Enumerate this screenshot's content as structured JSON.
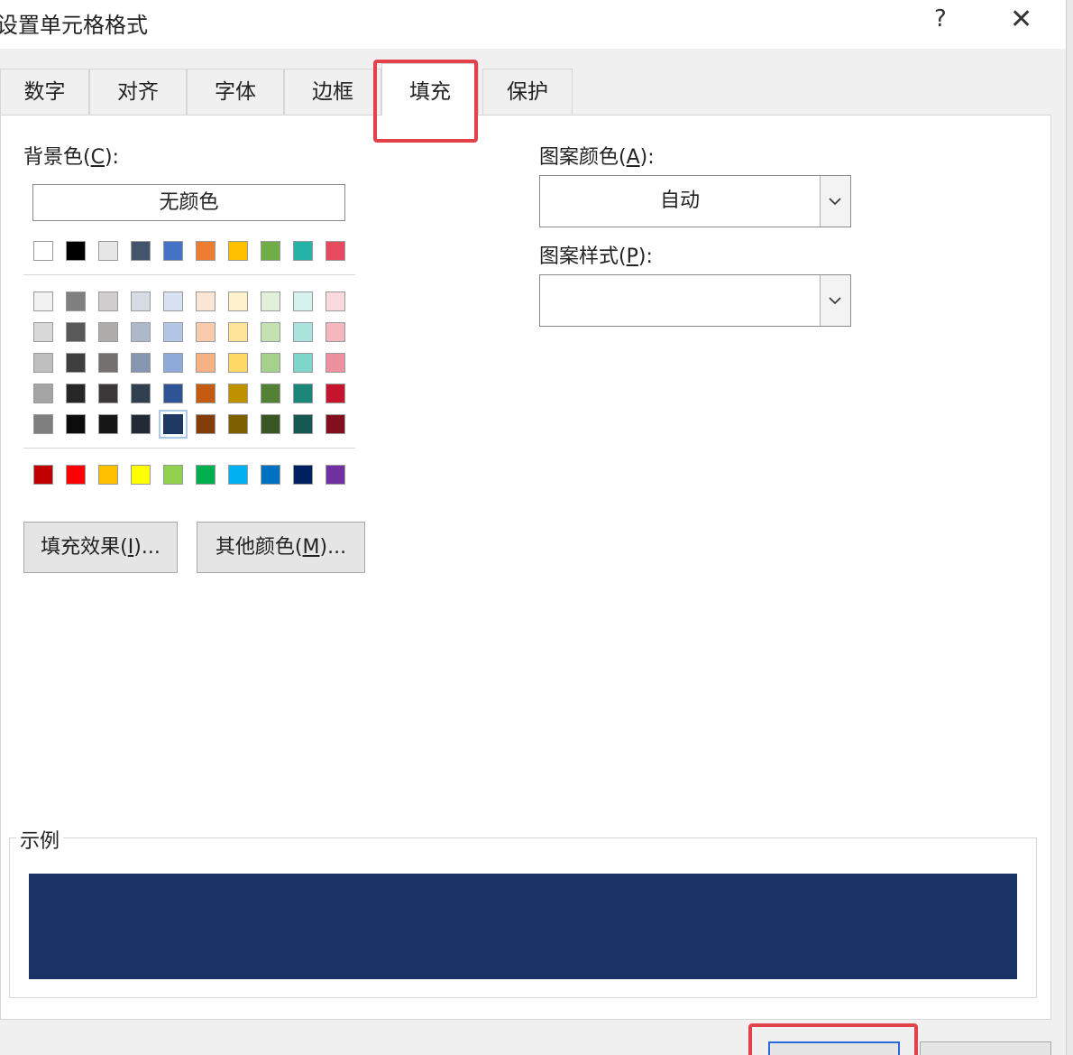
{
  "window": {
    "title": "设置单元格格式",
    "help_label": "?",
    "close_label": "✕"
  },
  "tabs": [
    {
      "label": "数字"
    },
    {
      "label": "对齐"
    },
    {
      "label": "字体"
    },
    {
      "label": "边框"
    },
    {
      "label": "填充",
      "active": true
    },
    {
      "label": "保护"
    }
  ],
  "background": {
    "label_prefix": "背景色(",
    "label_key": "C",
    "label_suffix": "):",
    "no_color_label": "无颜色",
    "selected": "#1f3864",
    "theme_row": [
      "#ffffff",
      "#000000",
      "#e7e6e6",
      "#44546a",
      "#4472c4",
      "#ed7d31",
      "#ffc000",
      "#70ad47",
      "#26b2a6",
      "#e84a5f"
    ],
    "shades": [
      [
        "#f2f2f2",
        "#7f7f7f",
        "#d0cece",
        "#d6dce4",
        "#d9e2f3",
        "#fbe5d5",
        "#fff2cc",
        "#e2efd9",
        "#d4f1ee",
        "#fadadd"
      ],
      [
        "#d8d8d8",
        "#595959",
        "#aeabab",
        "#adb9ca",
        "#b4c6e7",
        "#f7cbac",
        "#fee599",
        "#c5e0b3",
        "#a8e3dc",
        "#f4b6bf"
      ],
      [
        "#bfbfbf",
        "#3f3f3f",
        "#757070",
        "#8496b0",
        "#8eaadb",
        "#f4b183",
        "#ffd966",
        "#a8d08d",
        "#7dd5cb",
        "#ee919e"
      ],
      [
        "#a5a5a5",
        "#262626",
        "#3a3838",
        "#323f4f",
        "#2f5496",
        "#c55a11",
        "#bf9000",
        "#538135",
        "#1c8579",
        "#c5152e"
      ],
      [
        "#7f7f7f",
        "#0c0c0c",
        "#171616",
        "#222a35",
        "#1f3864",
        "#843c0b",
        "#7f6000",
        "#375623",
        "#135951",
        "#830e1e"
      ]
    ],
    "standard_row": [
      "#c00000",
      "#ff0000",
      "#ffc000",
      "#ffff00",
      "#92d050",
      "#00b050",
      "#00b0f0",
      "#0070c0",
      "#002060",
      "#7030a0"
    ]
  },
  "buttons": {
    "fill_effects_prefix": "填充效果(",
    "fill_effects_key": "I",
    "fill_effects_suffix": ")...",
    "more_colors_prefix": "其他颜色(",
    "more_colors_key": "M",
    "more_colors_suffix": ")..."
  },
  "pattern_color": {
    "label_prefix": "图案颜色(",
    "label_key": "A",
    "label_suffix": "):",
    "value": "自动"
  },
  "pattern_style": {
    "label_prefix": "图案样式(",
    "label_key": "P",
    "label_suffix": "):",
    "value": ""
  },
  "sample": {
    "label": "示例",
    "color": "#1a3366"
  },
  "colors": {
    "highlight": "#e3424a",
    "focus": "#2a6ad8"
  }
}
